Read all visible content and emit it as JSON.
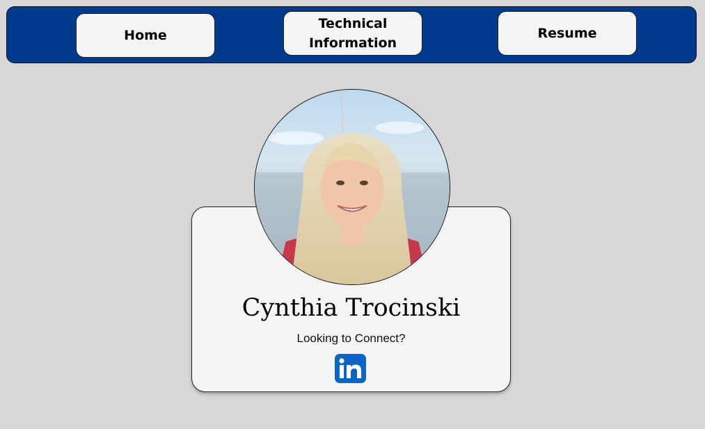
{
  "nav": {
    "home_label": "Home",
    "technical_label_line1": "Technical",
    "technical_label_line2": "Information",
    "resume_label": "Resume"
  },
  "profile": {
    "name": "Cynthia Trocinski",
    "tagline": "Looking to Connect?",
    "social_icon": "linkedin-icon"
  },
  "colors": {
    "nav_background": "#003a8c",
    "page_background": "#d8d6d7",
    "card_background": "#f4f4f4",
    "linkedin_blue": "#0a66c2"
  }
}
